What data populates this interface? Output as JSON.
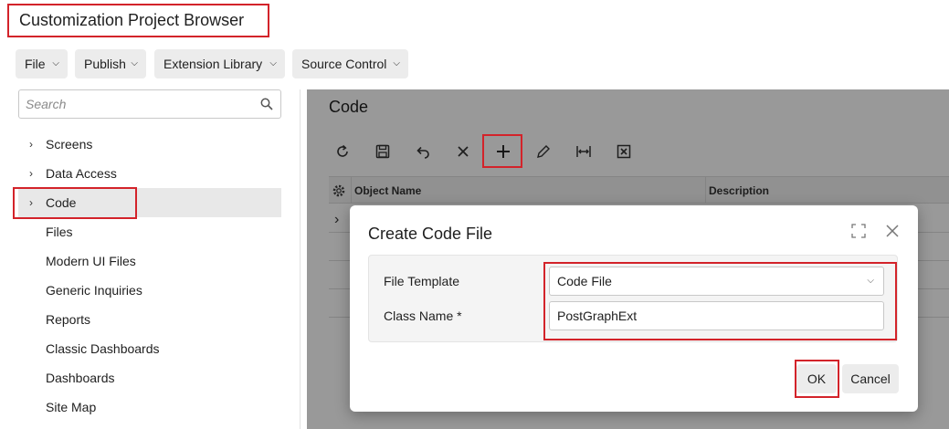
{
  "page_title": "Customization Project Browser",
  "menus": [
    {
      "label": "File"
    },
    {
      "label": "Publish"
    },
    {
      "label": "Extension Library"
    },
    {
      "label": "Source Control"
    }
  ],
  "search": {
    "placeholder": "Search",
    "value": ""
  },
  "tree": [
    {
      "label": "Screens",
      "expandable": true
    },
    {
      "label": "Data Access",
      "expandable": true
    },
    {
      "label": "Code",
      "expandable": true,
      "selected": true
    },
    {
      "label": "Files",
      "expandable": false
    },
    {
      "label": "Modern UI Files",
      "expandable": false
    },
    {
      "label": "Generic Inquiries",
      "expandable": false
    },
    {
      "label": "Reports",
      "expandable": false
    },
    {
      "label": "Classic Dashboards",
      "expandable": false
    },
    {
      "label": "Dashboards",
      "expandable": false
    },
    {
      "label": "Site Map",
      "expandable": false
    }
  ],
  "content": {
    "title": "Code",
    "toolbar": [
      "refresh-icon",
      "save-icon",
      "undo-icon",
      "delete-icon",
      "add-icon",
      "edit-icon",
      "fit-width-icon",
      "export-excel-icon"
    ],
    "grid": {
      "columns": [
        "Object Name",
        "Description"
      ]
    }
  },
  "dialog": {
    "title": "Create Code File",
    "fields": {
      "file_template": {
        "label": "File Template",
        "value": "Code File"
      },
      "class_name": {
        "label": "Class Name",
        "required_mark": "*",
        "value": "PostGraphExt"
      }
    },
    "ok_label": "OK",
    "cancel_label": "Cancel"
  },
  "colors": {
    "highlight": "#d3232a",
    "overlay": "rgba(0,0,0,0.40)",
    "button_bg": "#ececec"
  }
}
